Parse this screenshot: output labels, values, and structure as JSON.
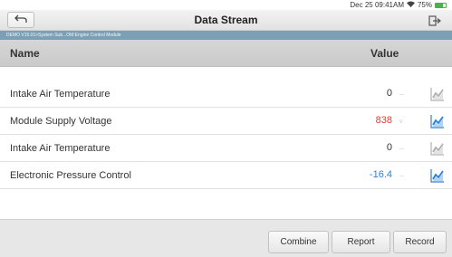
{
  "status_bar": {
    "datetime": "Dec 25 09:41AM",
    "battery": "75%",
    "battery_level": 0.75,
    "wifi_icon": "wifi-icon",
    "battery_color": "#4caf50"
  },
  "title_bar": {
    "title": "Data Stream",
    "back_icon": "back-arrow-icon",
    "export_icon": "export-icon"
  },
  "breadcrumb": "DEMO V15.01>System Sub...OM:Engine Control Module",
  "table": {
    "headers": {
      "name": "Name",
      "value": "Value"
    },
    "rows": [
      {
        "name": "Intake Air Temperature",
        "value": "0",
        "value_color": "#333333",
        "chart_active": false
      },
      {
        "name": "Module Supply Voltage",
        "value": "838",
        "value_color": "#e53935",
        "chart_active": true
      },
      {
        "name": "Intake Air Temperature",
        "value": "0",
        "value_color": "#333333",
        "chart_active": false
      },
      {
        "name": "Electronic Pressure Control",
        "value": "-16.4",
        "value_color": "#2f7fd8",
        "chart_active": true
      }
    ]
  },
  "buttons": {
    "combine": "Combine",
    "report": "Report",
    "record": "Record"
  },
  "colors": {
    "breadcrumb_bg": "#7d9fb3",
    "chart_active": "#2f7fd8",
    "chart_inactive": "#b0b0b0"
  }
}
